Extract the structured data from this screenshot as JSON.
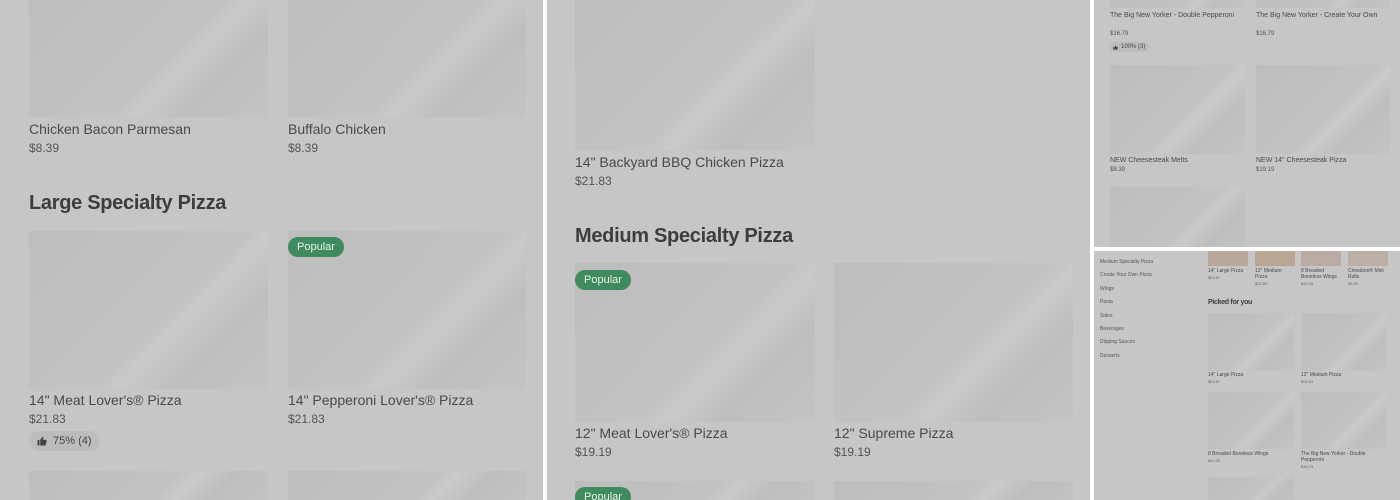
{
  "panel1": {
    "items_top": [
      {
        "name": "Chicken Bacon Parmesan",
        "price": "$8.39"
      },
      {
        "name": "Buffalo Chicken",
        "price": "$8.39"
      }
    ],
    "section_title": "Large Specialty Pizza",
    "items": [
      {
        "name": "14\" Meat Lover's® Pizza",
        "price": "$21.83",
        "rating": "75% (4)"
      },
      {
        "name": "14\" Pepperoni Lover's® Pizza",
        "price": "$21.83",
        "badge": "Popular"
      }
    ]
  },
  "panel2": {
    "item_top": {
      "name": "14\" Backyard BBQ Chicken Pizza",
      "price": "$21.83"
    },
    "section_title": "Medium Specialty Pizza",
    "items": [
      {
        "name": "12\" Meat Lover's® Pizza",
        "price": "$19.19",
        "badge": "Popular"
      },
      {
        "name": "12\" Supreme Pizza",
        "price": "$19.19"
      }
    ],
    "bottom_badge": "Popular"
  },
  "panel3": {
    "items": [
      {
        "name": "The Big New Yorker - Double Pepperoni",
        "price": "$16.79",
        "rating": "100% (3)"
      },
      {
        "name": "The Big New Yorker - Create Your Own",
        "price": "$16.79"
      },
      {
        "name": "NEW Cheesesteak Melts",
        "price": "$8.39"
      },
      {
        "name": "NEW 14\" Cheesesteak Pizza",
        "price": "$19.19"
      }
    ]
  },
  "panel4": {
    "nav": [
      "Medium Specialty Pizza",
      "Create Your Own Pizza",
      "Wings",
      "Pasta",
      "Sides",
      "Beverages",
      "Dipping Sauces",
      "Desserts"
    ],
    "carousel": [
      {
        "name": "14\" Large Pizza",
        "price": "$24.67"
      },
      {
        "name": "12\" Medium Pizza",
        "price": "$22.83"
      },
      {
        "name": "8 Breaded Boneless Wings",
        "price": "$10.05"
      },
      {
        "name": "Cinnabon® Mini Rolls",
        "price": "$8.39"
      }
    ],
    "section_title": "Picked for you",
    "picked": [
      {
        "name": "14\" Large Pizza",
        "price": "$24.67"
      },
      {
        "name": "12\" Medium Pizza",
        "price": "$22.83"
      },
      {
        "name": "8 Breaded Boneless Wings",
        "price": "$10.05"
      },
      {
        "name": "The Big New Yorker - Double Pepperoni",
        "price": "$16.79"
      }
    ]
  },
  "colors": {
    "overlay": "#c6c6c6",
    "badge_green": "#3f8a5e",
    "image_gray": "#bdbdbd"
  },
  "icons": {
    "rating": "thumbs-up-icon"
  }
}
